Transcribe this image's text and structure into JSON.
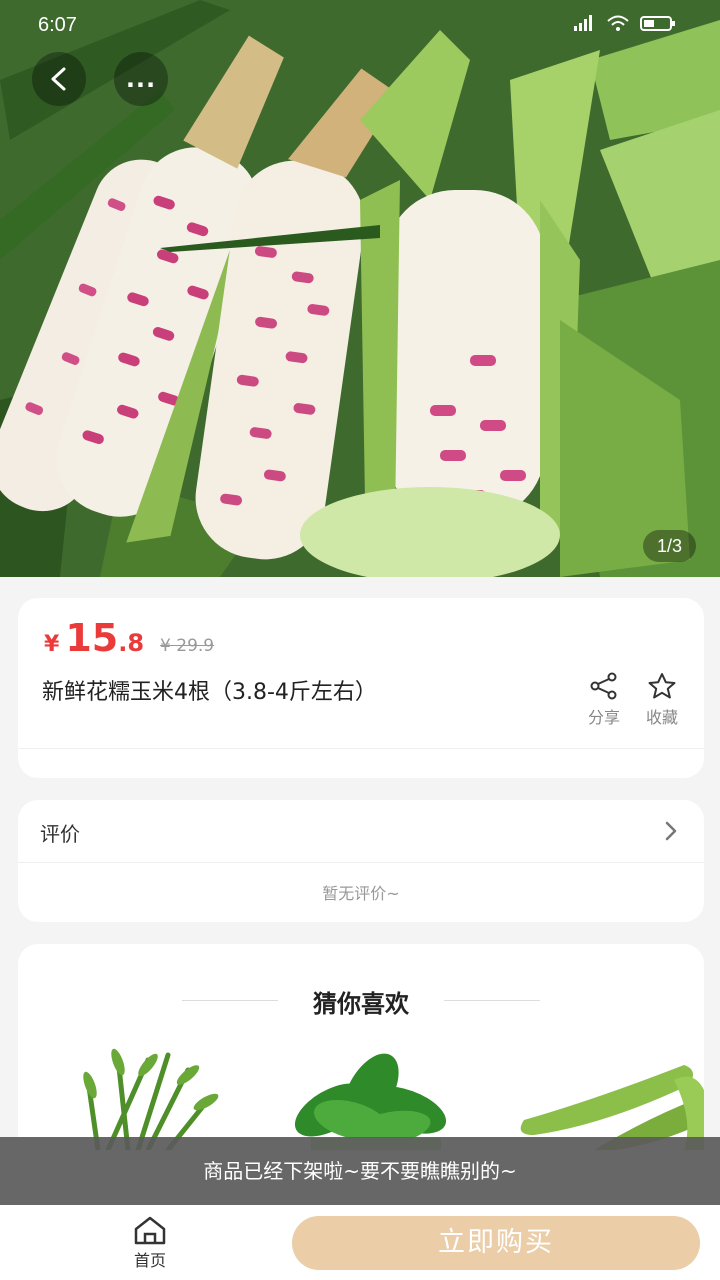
{
  "status_bar": {
    "time": "6:07",
    "battery_icon": "battery-icon",
    "wifi_icon": "wifi-icon",
    "signal_icon": "signal-icon"
  },
  "nav": {
    "back_icon": "chevron-left-icon",
    "more_icon": "more-icon",
    "more_label": "..."
  },
  "gallery": {
    "counter": "1/3",
    "subject": "waxy corn"
  },
  "product": {
    "currency": "¥",
    "price_int": "15",
    "price_dec": ".8",
    "original_price": "¥ 29.9",
    "title": "新鲜花糯玉米4根（3.8-4斤左右）",
    "price_color": "#ea3a3a"
  },
  "actions": {
    "share_label": "分享",
    "favorite_label": "收藏"
  },
  "reviews": {
    "header": "评价",
    "empty_text": "暂无评价~"
  },
  "recommend": {
    "title": "猜你喜欢",
    "items": [
      "water-spinach",
      "spinach",
      "broad-beans"
    ]
  },
  "toast": {
    "message": "商品已经下架啦~要不要瞧瞧别的~"
  },
  "bottom_bar": {
    "home_label": "首页",
    "buy_label": "立即购买",
    "buy_color": "#ebcda8"
  }
}
